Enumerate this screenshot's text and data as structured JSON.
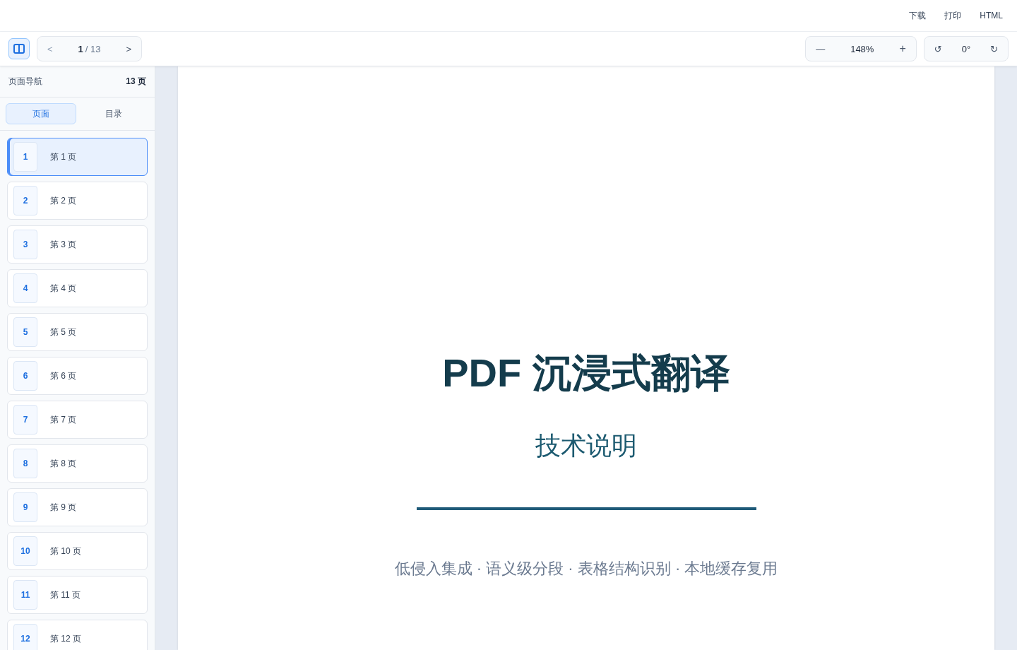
{
  "top_actions": [
    "下载",
    "打印",
    "HTML"
  ],
  "toolbar": {
    "sidebar_toggle": {
      "on": true
    },
    "prev": "<",
    "page_current": "1",
    "page_sep": "/ 13",
    "next": ">",
    "zoom_out": "—",
    "zoom": "148%",
    "zoom_in": "+",
    "rotate_left": "↺",
    "rotation": "0°",
    "rotate_right": "↻"
  },
  "sidebar": {
    "title": "页面导航",
    "count": "13 页",
    "tabs": [
      {
        "label": "页面",
        "selected": true
      },
      {
        "label": "目录",
        "selected": false
      }
    ],
    "pages": [
      {
        "number": "1",
        "label": "第 1 页",
        "selected": true
      },
      {
        "number": "2",
        "label": "第 2 页",
        "selected": false
      },
      {
        "number": "3",
        "label": "第 3 页",
        "selected": false
      },
      {
        "number": "4",
        "label": "第 4 页",
        "selected": false
      },
      {
        "number": "5",
        "label": "第 5 页",
        "selected": false
      },
      {
        "number": "6",
        "label": "第 6 页",
        "selected": false
      },
      {
        "number": "7",
        "label": "第 7 页",
        "selected": false
      },
      {
        "number": "8",
        "label": "第 8 页",
        "selected": false
      },
      {
        "number": "9",
        "label": "第 9 页",
        "selected": false
      },
      {
        "number": "10",
        "label": "第 10 页",
        "selected": false
      },
      {
        "number": "11",
        "label": "第 11 页",
        "selected": false
      },
      {
        "number": "12",
        "label": "第 12 页",
        "selected": false
      }
    ]
  },
  "document": {
    "title": "PDF 沉浸式翻译",
    "subtitle": "技术说明",
    "tagline": "低侵入集成 · 语义级分段 · 表格结构识别 · 本地缓存复用"
  }
}
